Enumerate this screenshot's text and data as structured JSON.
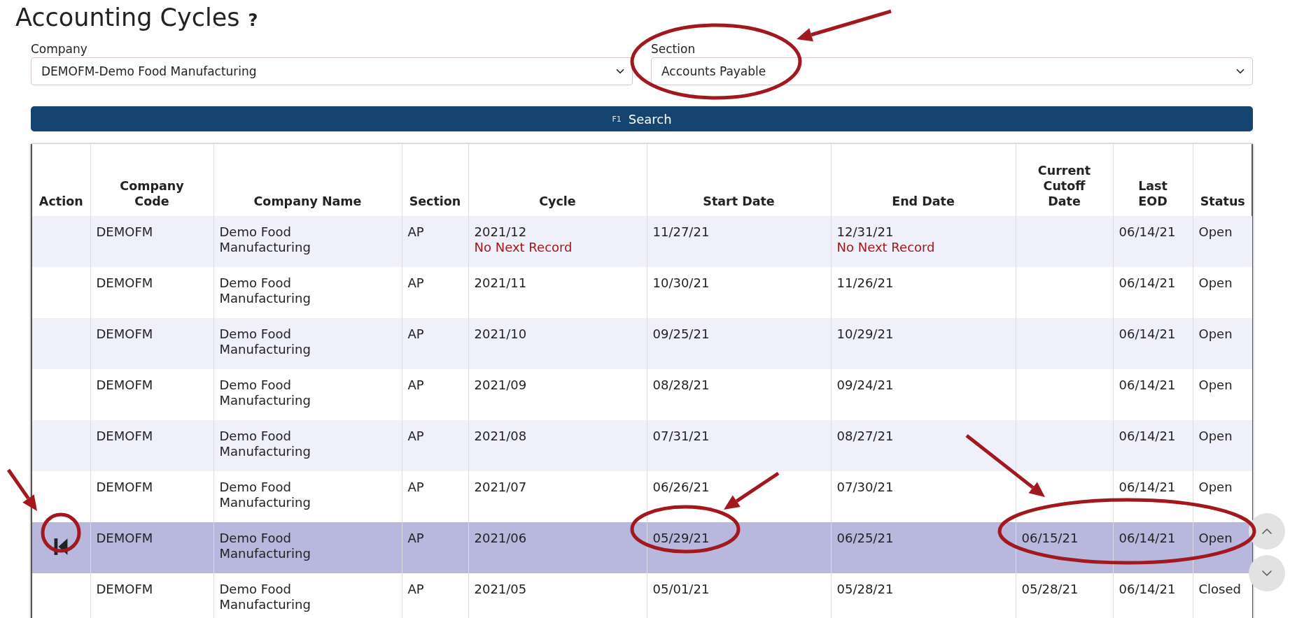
{
  "title": "Accounting Cycles",
  "help": "?",
  "filters": [
    {
      "label": "Company",
      "value": "DEMOFM-Demo Food Manufacturing"
    },
    {
      "label": "Section",
      "value": "Accounts Payable"
    }
  ],
  "search": {
    "shortcut": "F1",
    "label": "Search"
  },
  "table": {
    "columns": [
      "Action",
      "Company Code",
      "Company Name",
      "Section",
      "Cycle",
      "Start Date",
      "End Date",
      "Current Cutoff Date",
      "Last EOD",
      "Status"
    ],
    "rows": [
      {
        "selected": false,
        "code": "DEMOFM",
        "name": "Demo Food Manufacturing",
        "section": "AP",
        "cycle": "2021/12",
        "cycle_note": "No Next Record",
        "start": "11/27/21",
        "end": "12/31/21",
        "end_note": "No Next Record",
        "eod": "06/14/21",
        "status": "Open"
      },
      {
        "selected": false,
        "code": "DEMOFM",
        "name": "Demo Food Manufacturing",
        "section": "AP",
        "cycle": "2021/11",
        "start": "10/30/21",
        "end": "11/26/21",
        "eod": "06/14/21",
        "status": "Open"
      },
      {
        "selected": false,
        "code": "DEMOFM",
        "name": "Demo Food Manufacturing",
        "section": "AP",
        "cycle": "2021/10",
        "start": "09/25/21",
        "end": "10/29/21",
        "eod": "06/14/21",
        "status": "Open"
      },
      {
        "selected": false,
        "code": "DEMOFM",
        "name": "Demo Food Manufacturing",
        "section": "AP",
        "cycle": "2021/09",
        "start": "08/28/21",
        "end": "09/24/21",
        "eod": "06/14/21",
        "status": "Open"
      },
      {
        "selected": false,
        "code": "DEMOFM",
        "name": "Demo Food Manufacturing",
        "section": "AP",
        "cycle": "2021/08",
        "start": "07/31/21",
        "end": "08/27/21",
        "eod": "06/14/21",
        "status": "Open"
      },
      {
        "selected": false,
        "code": "DEMOFM",
        "name": "Demo Food Manufacturing",
        "section": "AP",
        "cycle": "2021/07",
        "start": "06/26/21",
        "end": "07/30/21",
        "eod": "06/14/21",
        "status": "Open"
      },
      {
        "selected": true,
        "code": "DEMOFM",
        "name": "Demo Food Manufacturing",
        "section": "AP",
        "cycle": "2021/06",
        "start": "05/29/21",
        "end": "06/25/21",
        "cutoff": "06/15/21",
        "eod": "06/14/21",
        "status": "Open"
      },
      {
        "selected": false,
        "code": "DEMOFM",
        "name": "Demo Food Manufacturing",
        "section": "AP",
        "cycle": "2021/05",
        "start": "05/01/21",
        "end": "05/28/21",
        "cutoff": "05/28/21",
        "eod": "06/14/21",
        "status": "Closed"
      }
    ]
  }
}
